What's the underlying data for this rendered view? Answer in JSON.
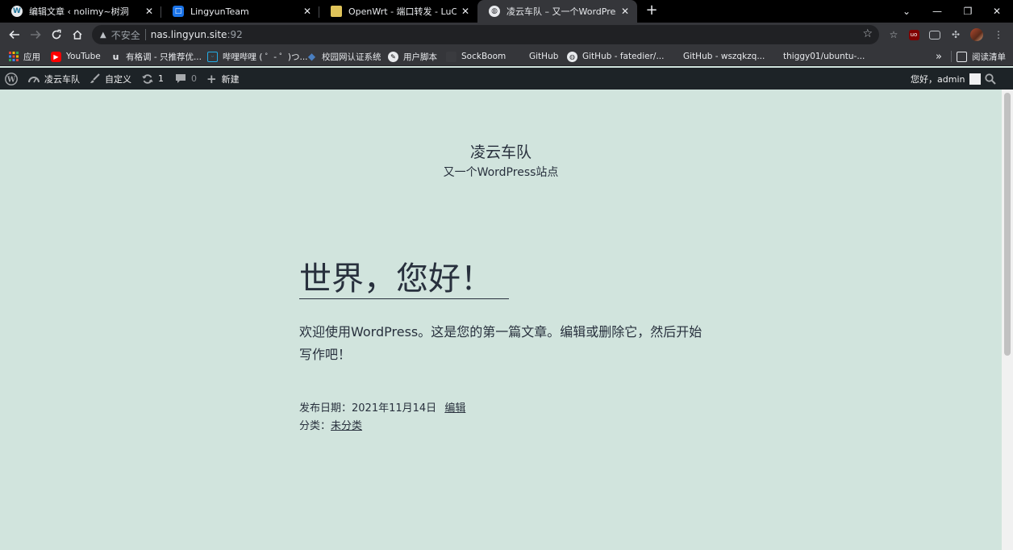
{
  "browser": {
    "tabs": [
      {
        "title": "编辑文章 ‹ nolimy~树洞",
        "active": false
      },
      {
        "title": "LingyunTeam",
        "active": false
      },
      {
        "title": "OpenWrt - 端口转发 - LuCI",
        "active": false
      },
      {
        "title": "凌云车队 – 又一个WordPress站点",
        "active": true
      }
    ],
    "address": {
      "security_label": "不安全",
      "host": "nas.lingyun.site",
      "port": ":92"
    },
    "bookmarks": [
      {
        "label": "应用",
        "icon": "apps-grid-icon"
      },
      {
        "label": "YouTube",
        "icon": "youtube-icon"
      },
      {
        "label": "有格调 - 只推荐优...",
        "icon": "bookmark-u-icon"
      },
      {
        "label": "哔哩哔哩 ( ゜- ゜)つ...",
        "icon": "bilibili-icon"
      },
      {
        "label": "校园网认证系统",
        "icon": "diamond-icon"
      },
      {
        "label": "用户脚本",
        "icon": "script-icon"
      },
      {
        "label": "SockBoom",
        "icon": "sockboom-icon"
      },
      {
        "label": "GitHub",
        "icon": "github-icon"
      },
      {
        "label": "GitHub - fatedier/...",
        "icon": "globe-icon"
      },
      {
        "label": "GitHub - wszqkzq...",
        "icon": "github-icon"
      },
      {
        "label": "thiggy01/ubuntu-...",
        "icon": "github-icon"
      }
    ],
    "bookmarks_overflow": "»",
    "reading_list": "阅读清单"
  },
  "admin_bar": {
    "site_name": "凌云车队",
    "customize": "自定义",
    "updates_count": "1",
    "comments_count": "0",
    "new_label": "新建",
    "greeting": "您好，admin"
  },
  "site": {
    "title": "凌云车队",
    "description": "又一个WordPress站点"
  },
  "post": {
    "title": "世界，您好！",
    "content": "欢迎使用WordPress。这是您的第一篇文章。编辑或删除它，然后开始写作吧！",
    "date_label": "发布日期：",
    "date": "2021年11月14日",
    "edit_label": "编辑",
    "category_label": "分类：",
    "category": "未分类"
  },
  "colors": {
    "page_background": "#d1e4dd",
    "admin_bar": "#1d2327",
    "text": "#28303d"
  }
}
